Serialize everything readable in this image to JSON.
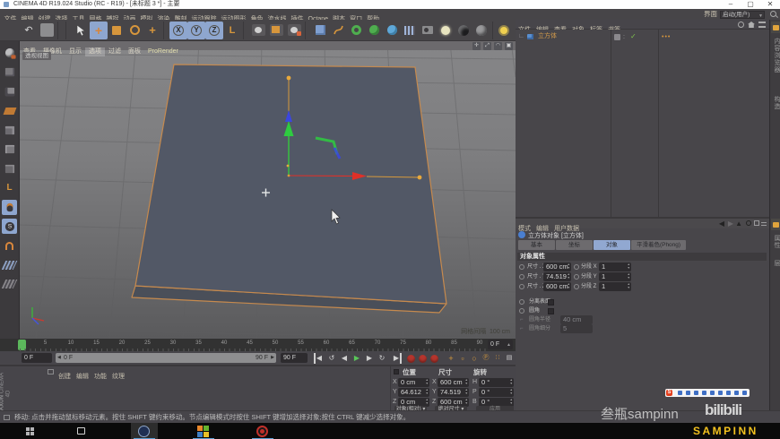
{
  "window": {
    "title": "CINEMA 4D R19.024 Studio (RC - R19) - [未标题 3 *] - 主要"
  },
  "menubar": {
    "items": [
      "文件",
      "编辑",
      "创建",
      "选择",
      "工具",
      "网格",
      "捕捉",
      "动画",
      "模拟",
      "渲染",
      "雕刻",
      "运动跟踪",
      "运动图形",
      "角色",
      "流水线",
      "插件",
      "Octane",
      "脚本",
      "窗口",
      "帮助"
    ],
    "interface_label": "界面",
    "interface_value": "启动(用户)"
  },
  "viewport": {
    "menu": [
      "查看",
      "摄像机",
      "显示",
      "选项",
      "过滤",
      "面板"
    ],
    "prorender": "ProRender",
    "view_label": "透视视图",
    "grid_hint_label": "网格间隔",
    "grid_hint_value": "100 cm"
  },
  "object_manager": {
    "menu": [
      "文件",
      "编辑",
      "查看",
      "对象",
      "标签",
      "书签"
    ],
    "object_name": "立方体"
  },
  "attributes": {
    "menu": [
      "模式",
      "编辑",
      "用户数据"
    ],
    "title": "立方体对象 [立方体]",
    "tabs": [
      "基本",
      "坐标",
      "对象",
      "平滑着色(Phong)"
    ],
    "active_tab": "对象",
    "section": "对象属性",
    "size_rows": [
      {
        "label": "尺寸 . X",
        "value": "600 cm",
        "label2": "分段 X",
        "value2": "1"
      },
      {
        "label": "尺寸 . Y",
        "value": "74.519 cm",
        "label2": "分段 Y",
        "value2": "1"
      },
      {
        "label": "尺寸 . Z",
        "value": "600 cm",
        "label2": "分段 Z",
        "value2": "1"
      }
    ],
    "checkbox_rows": [
      "分离表面",
      "圆角"
    ],
    "disabled_rows": [
      {
        "label": "圆角半径",
        "value": "40 cm"
      },
      {
        "label": "圆角细分",
        "value": "5"
      }
    ]
  },
  "side_tabs": {
    "upper": [
      "内容浏览器",
      "构造"
    ],
    "lower": [
      "属性",
      "层"
    ]
  },
  "timeline": {
    "tick_labels": [
      "5",
      "10",
      "15",
      "20",
      "25",
      "30",
      "35",
      "40",
      "45",
      "50",
      "55",
      "60",
      "65",
      "70",
      "75",
      "80",
      "85",
      "90"
    ],
    "frame_field": "0 F",
    "current_field": "0 F",
    "end_field": "90 F",
    "range_left": "0 F",
    "range_right": "90 F"
  },
  "materials": {
    "menu": [
      "创建",
      "编辑",
      "功能",
      "纹理"
    ],
    "brand_line1": "MAXON",
    "brand_line2": "CINEMA 4D"
  },
  "coordinates": {
    "headers": [
      "位置",
      "尺寸",
      "旋转"
    ],
    "rows": [
      {
        "axis": "X",
        "pos": "0 cm",
        "size": "600 cm",
        "rot_axis": "H",
        "rot": "0 °"
      },
      {
        "axis": "Y",
        "pos": "64.612 cm",
        "size": "74.519 cm",
        "rot_axis": "P",
        "rot": "0 °"
      },
      {
        "axis": "Z",
        "pos": "0 cm",
        "size": "600 cm",
        "rot_axis": "B",
        "rot": "0 °"
      }
    ],
    "footer": [
      "对象(相对)",
      "绝对尺寸",
      "应用"
    ]
  },
  "statusbar": {
    "text": "移动: 点击并拖动鼠标移动元素。按住 SHIFT 键约束移动。节点编辑模式时按住 SHIFT 键增加选择对象;按住 CTRL 键减少选择对象。"
  },
  "watermark": {
    "channel": "叁瓶sampinn",
    "site": "bilibili",
    "taskbar_name": "SAMPINN"
  }
}
